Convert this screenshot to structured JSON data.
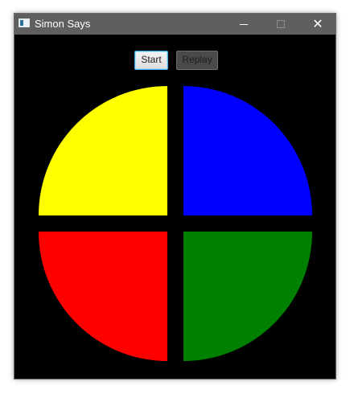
{
  "window": {
    "title": "Simon Says",
    "close_glyph": "✕"
  },
  "toolbar": {
    "start_label": "Start",
    "replay_label": "Replay",
    "replay_enabled": false
  },
  "board": {
    "background": "#000000",
    "quadrants": [
      {
        "name": "yellow-pad",
        "color": "#ffff00",
        "position": "top-left"
      },
      {
        "name": "blue-pad",
        "color": "#0000ff",
        "position": "top-right"
      },
      {
        "name": "red-pad",
        "color": "#ff0000",
        "position": "bottom-left"
      },
      {
        "name": "green-pad",
        "color": "#008000",
        "position": "bottom-right"
      }
    ]
  }
}
